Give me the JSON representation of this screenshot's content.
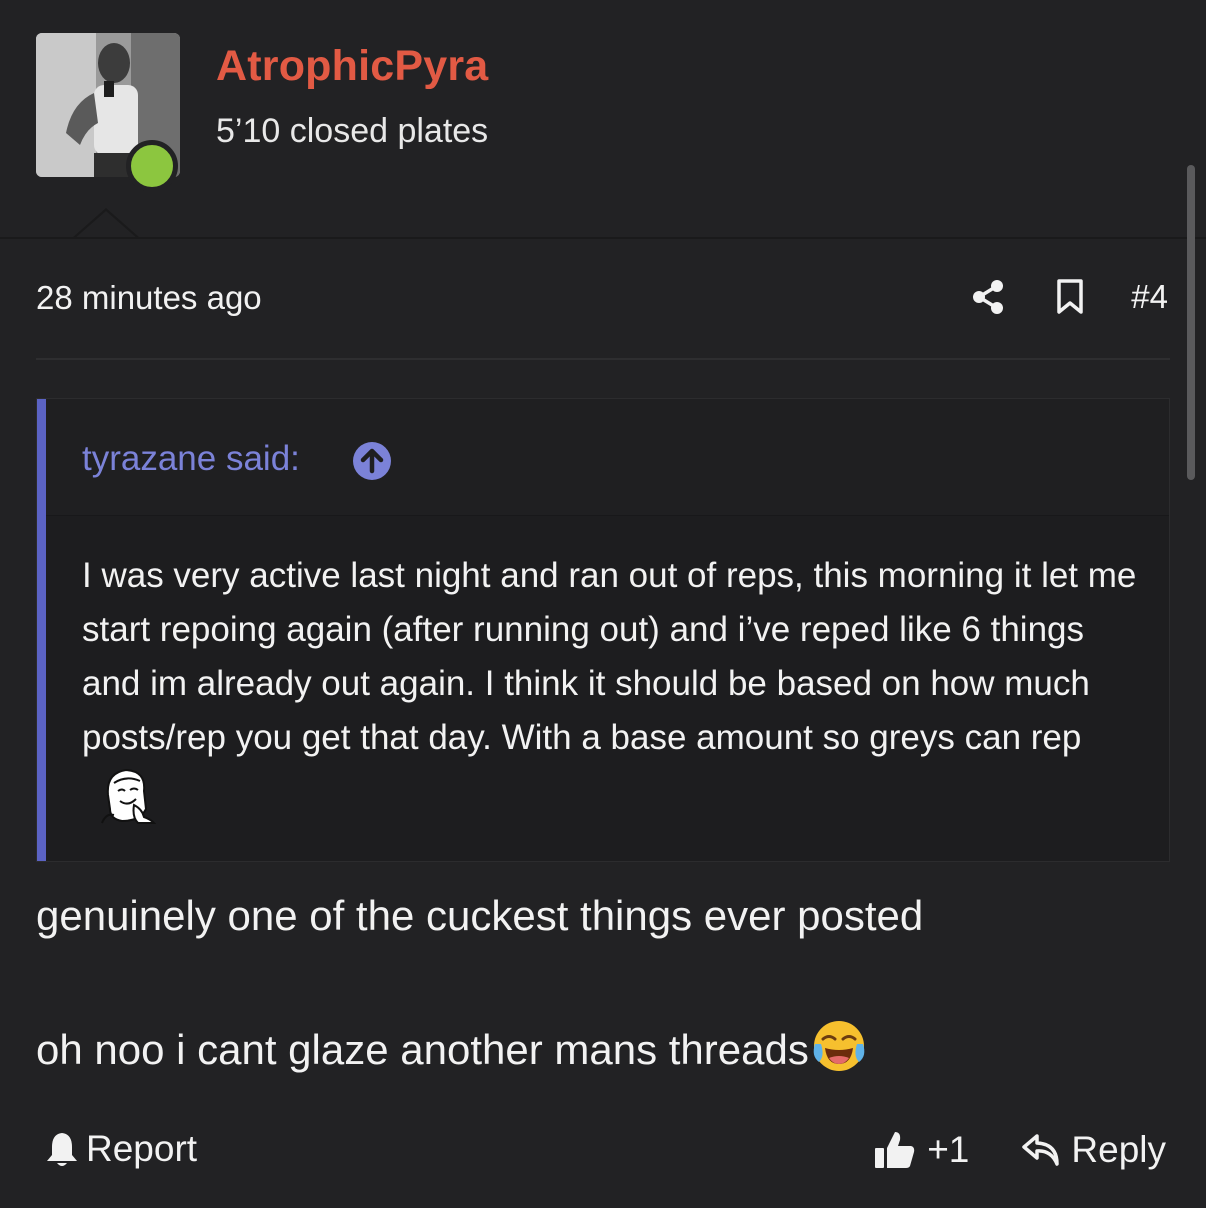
{
  "user": {
    "name": "AtrophicPyra",
    "title": "5’10 closed plates",
    "online_color": "#8cc63f",
    "name_color": "#e25a44"
  },
  "post": {
    "timestamp": "28 minutes ago",
    "number": "#4",
    "quote": {
      "author_label": "tyrazane said:",
      "body": "I was very active last night and ran out of reps, this morning it let me start repoing again (after running out) and i’ve reped like 6 things and im already out again. I think it should be based on how much posts/rep you get that day. With a base amount so greys can rep",
      "accent_color": "#5b63c4"
    },
    "lines": [
      "genuinely one of the cuckest things ever posted",
      "oh noo i cant glaze another mans threads"
    ]
  },
  "actions": {
    "report_label": "Report",
    "like_count": "+1",
    "reply_label": "Reply"
  },
  "icons": {
    "share": "share-icon",
    "bookmark": "bookmark-icon",
    "quote_jump": "arrow-up-circle-icon",
    "report": "bell-icon",
    "like": "thumbs-up-icon",
    "reply": "reply-arrow-icon",
    "meme": "meme-face-icon",
    "emoji": "face-with-tears-of-joy-icon"
  }
}
